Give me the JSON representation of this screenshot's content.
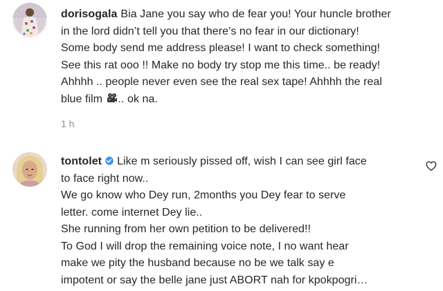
{
  "comments": [
    {
      "username": "dorisogala",
      "avatar_icon": "profile-photo-woman-floral-dress",
      "lines": [
        "Bia Jane you say who de fear you! Your huncle brother",
        "in the lord didn’t tell you that there’s no fear in our dictionary!",
        "Some body send me address please! I want to check something!",
        "See this rat ooo !! Make no body try stop me this time.. be ready!",
        "Ahhhh .. people never even see the real sex tape! Ahhhh the real"
      ],
      "last_line_before_emoji": "blue film ",
      "emoji_icon": "film-camera-emoji",
      "last_line_after_emoji": ".. ok na.",
      "timestamp": "1 h"
    },
    {
      "username": "tontolet",
      "verified_icon": "verified-badge-icon",
      "avatar_icon": "profile-photo-woman-blonde",
      "first_line": "Like m seriously pissed off, wish I can see girl face",
      "lines": [
        "to face right now..",
        "We go know who Dey run, 2months you Dey fear to serve",
        "letter. come internet Dey lie..",
        "She running from her own petition to be delivered!!",
        "To God I will drop the remaining voice note, I no want hear",
        "make we pity the husband because no be we talk say e",
        "impotent or say the belle jane just ABORT nah for kpokpogri…"
      ],
      "like_icon": "heart-outline-icon"
    }
  ]
}
